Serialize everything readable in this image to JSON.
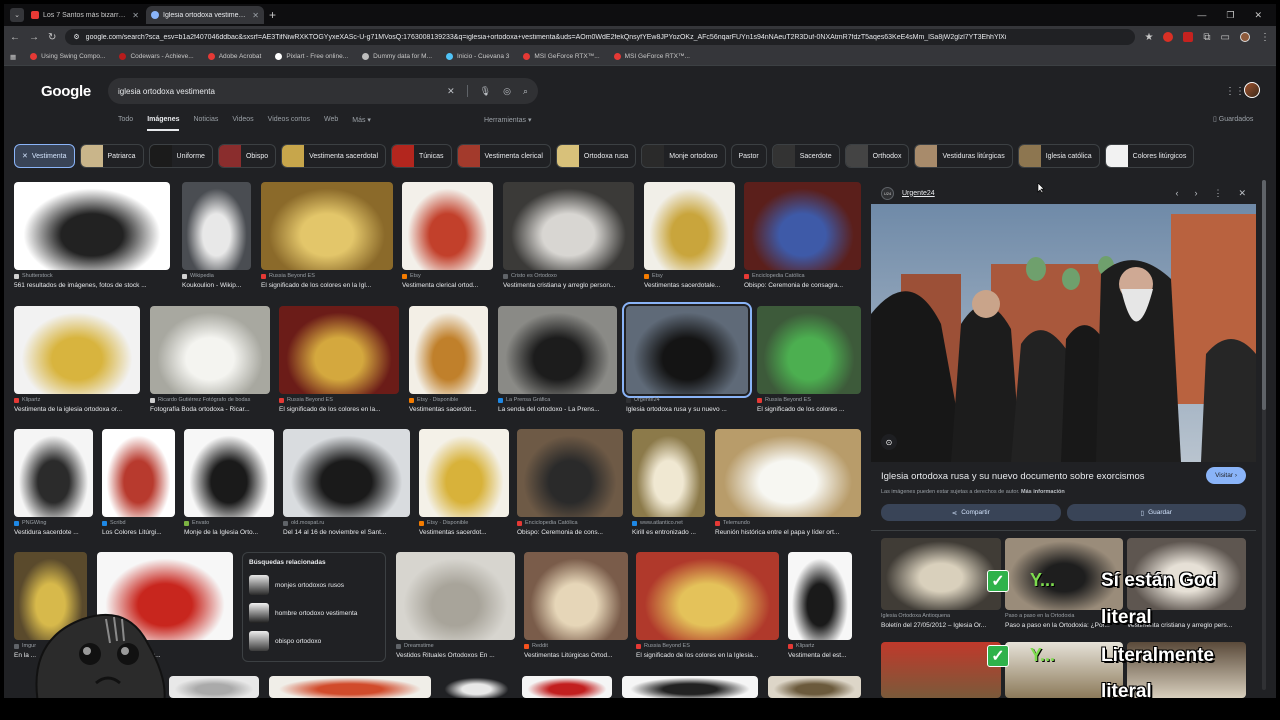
{
  "browser": {
    "tabs": [
      {
        "title": "Los 7 Santos más bizarros y cu",
        "fav_color": "#e53935"
      },
      {
        "title": "Iglesia ortodoxa vestimenta - B",
        "fav_color": "#8ab4f8"
      }
    ],
    "url": "google.com/search?sca_esv=b1a2f407046ddbac&sxsrf=AE3TifNiwRXKTOGYyxeXASc-U-g71MVosQ:1763008139233&q=iglesia+ortodoxa+vestimenta&uds=AOm0WdE2fekQnsyfYEw8JPYozOKz_AFc56nqarFUYn1s94nNAeuT2R3Duf-0NXAtmR7fdzT5aqes63KeE4sMm_lSa8jW2glzl7YT3EhhYlXi"
  },
  "bookmarks": [
    {
      "label": "Using Swing Compo...",
      "color": "#e53935"
    },
    {
      "label": "Codewars - Achieve...",
      "color": "#b71c1c"
    },
    {
      "label": "Adobe Acrobat",
      "color": "#e53935"
    },
    {
      "label": "Pixlart - Free online...",
      "color": "#ffffff"
    },
    {
      "label": "Dummy data for M...",
      "color": "#bdbdbd"
    },
    {
      "label": "Inicio - Cuevana 3",
      "color": "#4fc3f7"
    },
    {
      "label": "MSI GeForce RTX™...",
      "color": "#e53935"
    },
    {
      "label": "MSI GeForce RTX™...",
      "color": "#e53935"
    }
  ],
  "google": {
    "logo": "Google",
    "query": "iglesia ortodoxa vestimenta",
    "nav": [
      "Todo",
      "Imágenes",
      "Noticias",
      "Videos",
      "Videos cortos",
      "Web",
      "Más ▾"
    ],
    "tools": "Herramientas ▾",
    "saved": "Guardados"
  },
  "chips": [
    {
      "label": "Vestimenta",
      "selected": true
    },
    {
      "label": "Patriarca",
      "thumb": "#c9b58a"
    },
    {
      "label": "Uniforme",
      "thumb": "#1b1b1b"
    },
    {
      "label": "Obispo",
      "thumb": "#8a2d2d"
    },
    {
      "label": "Vestimenta sacerdotal",
      "thumb": "#c7a64b"
    },
    {
      "label": "Túnicas",
      "thumb": "#b3261e"
    },
    {
      "label": "Vestimenta clerical",
      "thumb": "#a33a2c"
    },
    {
      "label": "Ortodoxa rusa",
      "thumb": "#d8c17a"
    },
    {
      "label": "Monje ortodoxo",
      "thumb": "#2a2a2a"
    },
    {
      "label": "Pastor"
    },
    {
      "label": "Sacerdote",
      "thumb": "#333"
    },
    {
      "label": "Orthodox",
      "thumb": "#444"
    },
    {
      "label": "Vestiduras litúrgicas",
      "thumb": "#a88b6b"
    },
    {
      "label": "Iglesia católica",
      "thumb": "#8d7650"
    },
    {
      "label": "Colores litúrgicos",
      "thumb": "#f2f2f2"
    }
  ],
  "results": [
    {
      "src": "Shutterstock",
      "title": "561 resultados de imágenes, fotos de stock ...",
      "bg": "#ffffff",
      "fg": "#222",
      "sfc": "#cfcfcf"
    },
    {
      "src": "Wikipedia",
      "title": "Koukoulion - Wikip...",
      "bg": "#4a4d52",
      "fg": "#e8e8e8",
      "sfc": "#cfcfcf"
    },
    {
      "src": "Russia Beyond ES",
      "title": "El significado de los colores en la Igl...",
      "bg": "#8b6a2a",
      "fg": "#e3c66a",
      "sfc": "#e53935"
    },
    {
      "src": "Etsy",
      "title": "Vestimenta clerical ortod...",
      "bg": "#f3f0ea",
      "fg": "#c2402b",
      "sfc": "#f57c00"
    },
    {
      "src": "Cristo es Ortodoxo",
      "title": "Vestimenta cristiana y arreglo person...",
      "bg": "#3b3a38",
      "fg": "#d8d6d2",
      "sfc": "#5f6368"
    },
    {
      "src": "Etsy",
      "title": "Vestimentas sacerdotale...",
      "bg": "#f1efe8",
      "fg": "#c9a53c",
      "sfc": "#f57c00"
    },
    {
      "src": "Enciclopedia Católica",
      "title": "Obispo: Ceremonia de consagra...",
      "bg": "#5b1f1b",
      "fg": "#3e5aa8",
      "sfc": "#e53935"
    },
    {
      "src": "Klipartz",
      "title": "Vestimenta de la iglesia ortodoxa or...",
      "bg": "#f2f2f2",
      "fg": "#d8b43e",
      "sfc": "#e53935"
    },
    {
      "src": "Ricardo Gutiérrez Fotógrafo de bodas",
      "title": "Fotografía Boda ortodoxa - Ricar...",
      "bg": "#a8a8a0",
      "fg": "#f4f4f0",
      "sfc": "#cfcfcf"
    },
    {
      "src": "Russia Beyond ES",
      "title": "El significado de los colores en la...",
      "bg": "#6b1c18",
      "fg": "#d4a83e",
      "sfc": "#e53935"
    },
    {
      "src": "Etsy · Disponible",
      "title": "Vestimentas sacerdot...",
      "bg": "#f3efe6",
      "fg": "#c0802b",
      "sfc": "#f57c00"
    },
    {
      "src": "La Prensa Gráfica",
      "title": "La senda del ortodoxo - La Prens...",
      "bg": "#8a8a86",
      "fg": "#1c1c1c",
      "sfc": "#1e88e5"
    },
    {
      "src": "Urgente24",
      "title": "Iglesia ortodoxa rusa y su nuevo ...",
      "bg": "#5f6a78",
      "fg": "#141414",
      "sfc": "#303134"
    },
    {
      "src": "Russia Beyond ES",
      "title": "El significado de los colores ...",
      "bg": "#3d5a3a",
      "fg": "#4caf50",
      "sfc": "#e53935"
    },
    {
      "src": "PNGWing",
      "title": "Vestidura sacerdote ...",
      "bg": "#f5f5f5",
      "fg": "#2b2b2b",
      "sfc": "#1e88e5"
    },
    {
      "src": "Scribd",
      "title": "Los Colores Litúrgi...",
      "bg": "#ffffff",
      "fg": "#b83a2e",
      "sfc": "#1e88e5"
    },
    {
      "src": "Envato",
      "title": "Monje de la Iglesia Orto...",
      "bg": "#f7f7f7",
      "fg": "#1a1a1a",
      "sfc": "#7cb342"
    },
    {
      "src": "old.mospat.ru",
      "title": "Del 14 al 16 de noviembre el Sant...",
      "bg": "#d9dcdf",
      "fg": "#1a1a1a",
      "sfc": "#5f6368"
    },
    {
      "src": "Etsy · Disponible",
      "title": "Vestimentas sacerdot...",
      "bg": "#f4f1e8",
      "fg": "#d8b23a",
      "sfc": "#f57c00"
    },
    {
      "src": "Enciclopedia Católica",
      "title": "Obispo: Ceremonia de cons...",
      "bg": "#6e5a46",
      "fg": "#2a2a2a",
      "sfc": "#e53935"
    },
    {
      "src": "www.atlantico.net",
      "title": "Kirill es entronizado ...",
      "bg": "#8c7a4a",
      "fg": "#f0e8d2",
      "sfc": "#1e88e5"
    },
    {
      "src": "Telemundo",
      "title": "Reunión histórica entre el papa y líder ort...",
      "bg": "#b89c6a",
      "fg": "#f7f7f2",
      "sfc": "#e53935"
    },
    {
      "src": "Imgur",
      "title": "En la ...",
      "bg": "#5a4a2c",
      "fg": "#d7b94b",
      "sfc": "#5f6368"
    },
    {
      "src": "",
      "title": "...odoxa oriental sac...",
      "bg": "#f7f7f7",
      "fg": "#c8261e",
      "sfc": "#5f6368"
    },
    {
      "src": "Dreamstime",
      "title": "Vestidos Rituales Ortodoxos En ...",
      "bg": "#d7d5cf",
      "fg": "#a8a49a",
      "sfc": "#5f6368"
    },
    {
      "src": "Reddit",
      "title": "Vestimentas Litúrgicas Ortod...",
      "bg": "#7a5c4a",
      "fg": "#e6d6b8",
      "sfc": "#f4511e"
    },
    {
      "src": "Russia Beyond ES",
      "title": "El significado de los colores en la Iglesia...",
      "bg": "#b0392b",
      "fg": "#e4c25a",
      "sfc": "#e53935"
    },
    {
      "src": "Klipartz",
      "title": "Vestimenta del est...",
      "bg": "#f7f7f7",
      "fg": "#1a1a1a",
      "sfc": "#e53935"
    },
    {
      "src": "",
      "title": "",
      "bg": "#e8e8e8",
      "fg": "#aaa",
      "sfc": "#5f6368"
    },
    {
      "src": "",
      "title": "",
      "bg": "#f0eee8",
      "fg": "#d14b2b",
      "sfc": "#5f6368"
    },
    {
      "src": "",
      "title": "",
      "bg": "#202124",
      "fg": "#e8e8e8",
      "sfc": "#5f6368"
    },
    {
      "src": "",
      "title": "",
      "bg": "#f5f5f5",
      "fg": "#c21f1f",
      "sfc": "#5f6368"
    },
    {
      "src": "",
      "title": "",
      "bg": "#f5f5f5",
      "fg": "#222",
      "sfc": "#5f6368"
    },
    {
      "src": "",
      "title": "",
      "bg": "#ddd6c8",
      "fg": "#6b5a3c",
      "sfc": "#5f6368"
    }
  ],
  "related": {
    "heading": "Búsquedas relacionadas",
    "items": [
      {
        "label": "monjes ortodoxos rusos"
      },
      {
        "label": "hombre ortodoxo vestimenta"
      },
      {
        "label": "obispo ortodoxo"
      }
    ]
  },
  "panel": {
    "source": "Urgente24",
    "favicon_text": "U24",
    "title": "Iglesia ortodoxa rusa y su nuevo documento sobre exorcismos",
    "visit": "Visitar ›",
    "note": "Las imágenes pueden estar sujetas a derechos de autor.",
    "more": "Más información",
    "share": "Compartir",
    "save": "Guardar",
    "related": [
      {
        "src": "Iglesia Ortodoxa Antioquena",
        "title": "Boletín del 27/05/2012 – Iglesia Or...",
        "bg": "#403c36",
        "fg": "#d9d0bc"
      },
      {
        "src": "Paso a paso en la Ortodoxia",
        "title": "Paso a paso en la Ortodoxia: ¿Por...",
        "bg": "#9a8c7a",
        "fg": "#1e1e1e"
      },
      {
        "src": "",
        "title": "Vestimenta cristiana y arreglo pers...",
        "bg": "#5e5650",
        "fg": "#e6e0d6"
      }
    ]
  },
  "overlay": {
    "checks": [
      "✓",
      "✓"
    ],
    "y_marks": [
      "Y...",
      "Y..."
    ],
    "captions": [
      "Sí están God",
      "literal",
      "Literalmente",
      "literal"
    ]
  }
}
